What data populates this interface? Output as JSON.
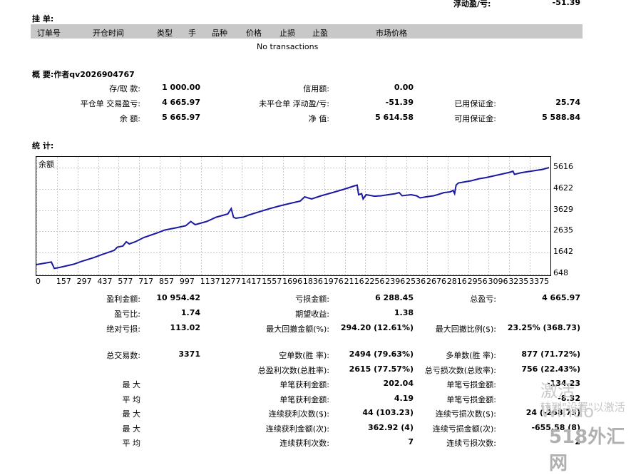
{
  "top_summary": {
    "label": "浮动盈/亏:",
    "value": "-51.39"
  },
  "orders": {
    "title": "挂 单:",
    "columns": [
      "订单号",
      "开仓时间",
      "类型",
      "手",
      "品种",
      "价格",
      "止损",
      "止盈",
      "市场价格"
    ],
    "empty_text": "No transactions"
  },
  "summary": {
    "title": "概 要:作者qv2026904767",
    "rows": [
      {
        "l1": "存/取 款:",
        "v1": "1 000.00",
        "l2": "信用额:",
        "v2": "0.00",
        "l3": "",
        "v3": ""
      },
      {
        "l1": "平仓单 交易盈亏:",
        "v1": "4 665.97",
        "l2": "未平仓单 浮动盈/亏:",
        "v2": "-51.39",
        "l3": "已用保证金:",
        "v3": "25.74"
      },
      {
        "l1": "余 额:",
        "v1": "5 665.97",
        "l2": "净 值:",
        "v2": "5 614.58",
        "l3": "可用保证金:",
        "v3": "5 588.84"
      }
    ]
  },
  "stats_title": "统 计:",
  "chart_data": {
    "type": "line",
    "title": "余额",
    "x_ticks": [
      "0",
      "157",
      "297",
      "437",
      "577",
      "717",
      "857",
      "997",
      "1137",
      "1277",
      "1417",
      "1557",
      "1696",
      "1836",
      "1976",
      "2116",
      "2256",
      "2396",
      "2536",
      "2676",
      "2816",
      "2956",
      "3096",
      "3235",
      "3375"
    ],
    "y_ticks": [
      "5616",
      "4622",
      "3629",
      "2635",
      "1642",
      "648"
    ],
    "ylim": [
      648,
      5616
    ],
    "xlim": [
      0,
      3420
    ],
    "grid": true,
    "series": [
      {
        "color": "#1a1aa0",
        "x": [
          0,
          100,
          120,
          157,
          250,
          297,
          380,
          437,
          500,
          520,
          540,
          577,
          600,
          620,
          660,
          717,
          800,
          857,
          930,
          997,
          1030,
          1060,
          1137,
          1200,
          1277,
          1300,
          1315,
          1330,
          1380,
          1417,
          1500,
          1557,
          1620,
          1696,
          1760,
          1790,
          1836,
          1900,
          1976,
          2050,
          2116,
          2140,
          2150,
          2170,
          2180,
          2200,
          2256,
          2300,
          2396,
          2420,
          2440,
          2500,
          2536,
          2560,
          2600,
          2650,
          2676,
          2720,
          2760,
          2780,
          2790,
          2800,
          2816,
          2900,
          2956,
          3000,
          3096,
          3160,
          3180,
          3190,
          3235,
          3300,
          3375,
          3420
        ],
        "y": [
          1080,
          1200,
          900,
          950,
          1100,
          1220,
          1400,
          1550,
          1700,
          1750,
          1900,
          1950,
          2150,
          2050,
          2150,
          2350,
          2550,
          2700,
          2800,
          2900,
          3100,
          2950,
          3100,
          3300,
          3450,
          3700,
          3300,
          3250,
          3300,
          3400,
          3580,
          3700,
          3820,
          3950,
          4050,
          4250,
          4150,
          4300,
          4450,
          4600,
          4750,
          4800,
          4350,
          4400,
          4150,
          4350,
          4280,
          4300,
          4400,
          4450,
          4300,
          4350,
          4300,
          4200,
          4250,
          4300,
          4350,
          4450,
          4480,
          4550,
          4400,
          4800,
          4900,
          5000,
          5100,
          5150,
          5300,
          5400,
          5450,
          5300,
          5380,
          5450,
          5530,
          5616
        ]
      }
    ]
  },
  "stats": {
    "block1": [
      {
        "l1": "盈利金额:",
        "v1": "10 954.42",
        "l2": "亏损金额:",
        "v2": "6 288.45",
        "l3": "总盈亏:",
        "v3": "4 665.97"
      },
      {
        "l1": "盈亏比:",
        "v1": "1.74",
        "l2": "期望收益:",
        "v2": "1.38",
        "l3": "",
        "v3": ""
      },
      {
        "l1": "绝对亏损:",
        "v1": "113.02",
        "l2": "最大回撤金额(%):",
        "v2": "294.20 (12.61%)",
        "l3": "最大回撤比例($):",
        "v3": "23.25% (368.73)"
      }
    ],
    "block2": [
      {
        "l1": "总交易数:",
        "v1": "3371",
        "l2": "空单数(胜 率):",
        "v2": "2494 (79.63%)",
        "l3": "多单数(胜 率):",
        "v3": "877 (71.72%)"
      },
      {
        "l1": "",
        "v1": "",
        "l2": "总盈利次数(总胜率):",
        "v2": "2615 (77.57%)",
        "l3": "总亏损次数(总败率):",
        "v3": "756 (22.43%)"
      },
      {
        "l1": "最 大",
        "v1": "",
        "l2": "单笔获利金额:",
        "v2": "202.04",
        "l3": "单笔亏损金额:",
        "v3": "-134.23"
      },
      {
        "l1": "平 均",
        "v1": "",
        "l2": "单笔获利金额:",
        "v2": "4.19",
        "l3": "单笔亏损金额:",
        "v3": "-8.32"
      },
      {
        "l1": "最 大",
        "v1": "",
        "l2": "连续获利次数($):",
        "v2": "44 (103.23)",
        "l3": "连续亏损次数($):",
        "v3": "24 (-268.73)"
      },
      {
        "l1": "最 大",
        "v1": "",
        "l2": "连续获利金额(次):",
        "v2": "362.92 (4)",
        "l3": "连续亏损金额(次):",
        "v3": "-655.58 (8)"
      },
      {
        "l1": "平 均",
        "v1": "",
        "l2": "连续获利次数:",
        "v2": "7",
        "l3": "连续亏损次数:",
        "v3": "2"
      }
    ]
  },
  "watermarks": {
    "line1": "激活 Windo",
    "line2": "转到\"设置\"以激活",
    "line3": "518外汇网"
  }
}
